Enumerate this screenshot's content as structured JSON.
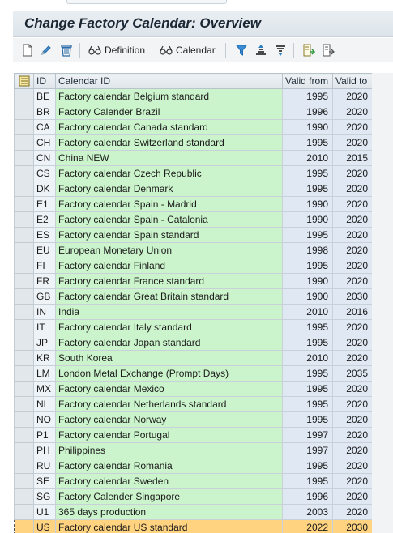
{
  "header": {
    "title": "Change Factory Calendar: Overview"
  },
  "toolbar": {
    "definition_label": "Definition",
    "calendar_label": "Calendar"
  },
  "table": {
    "columns": {
      "id": "ID",
      "calendar_id": "Calendar ID",
      "valid_from": "Valid from",
      "valid_to": "Valid to"
    },
    "rows": [
      {
        "id": "BE",
        "name": "Factory calendar Belgium standard",
        "from": "1995",
        "to": "2020"
      },
      {
        "id": "BR",
        "name": "Factory Calender Brazil",
        "from": "1996",
        "to": "2020"
      },
      {
        "id": "CA",
        "name": "Factory calendar Canada standard",
        "from": "1990",
        "to": "2020"
      },
      {
        "id": "CH",
        "name": "Factory calendar Switzerland standard",
        "from": "1995",
        "to": "2020"
      },
      {
        "id": "CN",
        "name": "China NEW",
        "from": "2010",
        "to": "2015"
      },
      {
        "id": "CS",
        "name": "Factory calendar Czech Republic",
        "from": "1995",
        "to": "2020"
      },
      {
        "id": "DK",
        "name": "Factory calendar Denmark",
        "from": "1995",
        "to": "2020"
      },
      {
        "id": "E1",
        "name": "Factory calendar Spain - Madrid",
        "from": "1990",
        "to": "2020"
      },
      {
        "id": "E2",
        "name": "Factory calendar Spain - Catalonia",
        "from": "1990",
        "to": "2020"
      },
      {
        "id": "ES",
        "name": "Factory calendar Spain standard",
        "from": "1995",
        "to": "2020"
      },
      {
        "id": "EU",
        "name": "European Monetary Union",
        "from": "1998",
        "to": "2020"
      },
      {
        "id": "FI",
        "name": "Factory calendar Finland",
        "from": "1995",
        "to": "2020"
      },
      {
        "id": "FR",
        "name": "Factory calendar France standard",
        "from": "1990",
        "to": "2020"
      },
      {
        "id": "GB",
        "name": "Factory calendar Great Britain standard",
        "from": "1900",
        "to": "2030"
      },
      {
        "id": "IN",
        "name": "India",
        "from": "2010",
        "to": "2016"
      },
      {
        "id": "IT",
        "name": "Factory calendar Italy standard",
        "from": "1995",
        "to": "2020"
      },
      {
        "id": "JP",
        "name": "Factory calendar Japan standard",
        "from": "1995",
        "to": "2020"
      },
      {
        "id": "KR",
        "name": "South Korea",
        "from": "2010",
        "to": "2020"
      },
      {
        "id": "LM",
        "name": "London Metal Exchange (Prompt Days)",
        "from": "1995",
        "to": "2035"
      },
      {
        "id": "MX",
        "name": "Factory calendar Mexico",
        "from": "1995",
        "to": "2020"
      },
      {
        "id": "NL",
        "name": "Factory calendar Netherlands standard",
        "from": "1995",
        "to": "2020"
      },
      {
        "id": "NO",
        "name": "Factory calendar Norway",
        "from": "1995",
        "to": "2020"
      },
      {
        "id": "P1",
        "name": "Factory calendar Portugal",
        "from": "1997",
        "to": "2020"
      },
      {
        "id": "PH",
        "name": "Philippines",
        "from": "1997",
        "to": "2020"
      },
      {
        "id": "RU",
        "name": "Factory calendar Romania",
        "from": "1995",
        "to": "2020"
      },
      {
        "id": "SE",
        "name": "Factory calendar Sweden",
        "from": "1995",
        "to": "2020"
      },
      {
        "id": "SG",
        "name": "Factory Calender Singapore",
        "from": "1996",
        "to": "2020"
      },
      {
        "id": "U1",
        "name": "365 days production",
        "from": "2003",
        "to": "2020"
      },
      {
        "id": "US",
        "name": "Factory calendar US standard",
        "from": "2022",
        "to": "2030",
        "selected": true
      }
    ]
  },
  "icons": {
    "create": "new-document-icon",
    "edit": "pencil-icon",
    "delete": "trash-icon",
    "definition": "glasses-icon",
    "calendar": "glasses-icon",
    "filter": "filter-icon",
    "sort_asc": "sort-ascending-icon",
    "sort_desc": "sort-descending-icon",
    "export": "export-icon",
    "layout": "layout-icon",
    "select_all": "select-all-icon"
  },
  "colors": {
    "name_cell": "#ccf4cc",
    "id_cell": "#eef3f8",
    "number_cell": "#dfe8f3",
    "selected_row": "#ffd37f",
    "toolbar_icon": "#2a7fc1"
  }
}
